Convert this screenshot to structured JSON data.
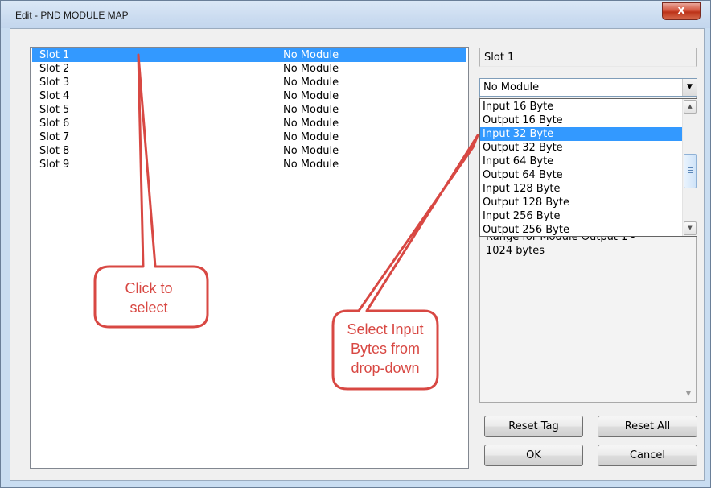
{
  "window": {
    "title": "Edit - PND MODULE MAP",
    "close_glyph": "x"
  },
  "slots": [
    {
      "name": "Slot 1",
      "module": "No Module"
    },
    {
      "name": "Slot 2",
      "module": "No Module"
    },
    {
      "name": "Slot 3",
      "module": "No Module"
    },
    {
      "name": "Slot 4",
      "module": "No Module"
    },
    {
      "name": "Slot 5",
      "module": "No Module"
    },
    {
      "name": "Slot 6",
      "module": "No Module"
    },
    {
      "name": "Slot 7",
      "module": "No Module"
    },
    {
      "name": "Slot 8",
      "module": "No Module"
    },
    {
      "name": "Slot 9",
      "module": "No Module"
    }
  ],
  "selected_slot_label": "Slot 1",
  "module_select": {
    "value": "No Module",
    "options": [
      "Input 16 Byte",
      "Output 16 Byte",
      "Input 32 Byte",
      "Output 32 Byte",
      "Input 64 Byte",
      "Output 64 Byte",
      "Input 128 Byte",
      "Output 128 Byte",
      "Input 256 Byte",
      "Output 256 Byte"
    ],
    "highlighted": "Input 32 Byte"
  },
  "description": {
    "line1": "Range for Module Output 1 - ",
    "line2": "1024 bytes"
  },
  "buttons": {
    "reset_tag": "Reset Tag",
    "reset_all": "Reset All",
    "ok": "OK",
    "cancel": "Cancel"
  },
  "callouts": {
    "click": "Click to select",
    "click_line1": "Click to",
    "click_line2": "select",
    "dropdown_line1": "Select Input",
    "dropdown_line2": "Bytes from",
    "dropdown_line3": "drop-down"
  },
  "colors": {
    "selection": "#3399ff",
    "callout_stroke": "#d84843",
    "title_bar": "#cbdcf0",
    "close_button": "#c8412a"
  }
}
